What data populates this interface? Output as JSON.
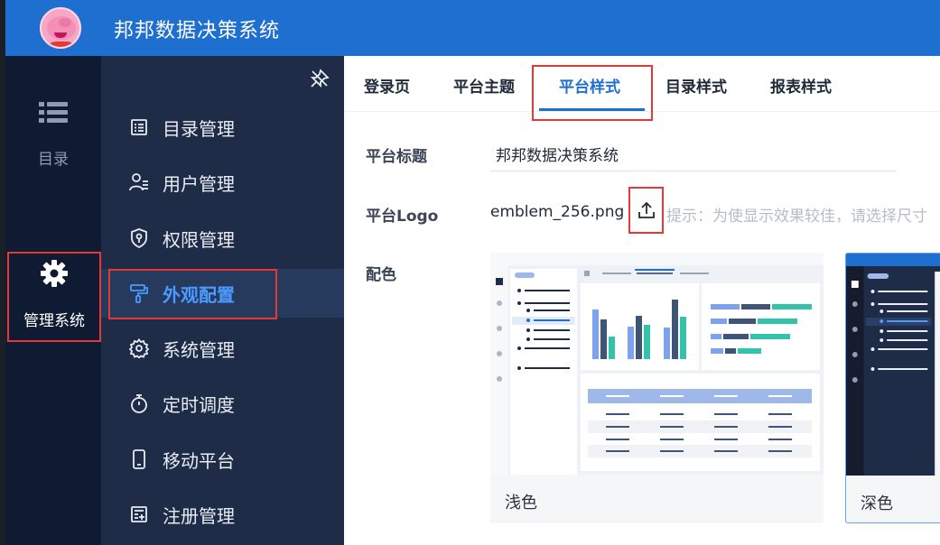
{
  "header": {
    "app_title": "邦邦数据决策系统"
  },
  "rail": {
    "items": [
      {
        "name": "list-icon",
        "label": "目录"
      },
      {
        "name": "gear-icon",
        "label": "管理系统"
      }
    ]
  },
  "menu": {
    "items": [
      {
        "label": "目录管理",
        "icon": "catalog-icon"
      },
      {
        "label": "用户管理",
        "icon": "user-icon"
      },
      {
        "label": "权限管理",
        "icon": "shield-icon"
      },
      {
        "label": "外观配置",
        "icon": "paint-roller-icon",
        "active": true
      },
      {
        "label": "系统管理",
        "icon": "gear-icon"
      },
      {
        "label": "定时调度",
        "icon": "stopwatch-icon"
      },
      {
        "label": "移动平台",
        "icon": "mobile-icon"
      },
      {
        "label": "注册管理",
        "icon": "register-icon"
      }
    ]
  },
  "tabs": [
    {
      "label": "登录页"
    },
    {
      "label": "平台主题"
    },
    {
      "label": "平台样式",
      "active": true
    },
    {
      "label": "目录样式"
    },
    {
      "label": "报表样式"
    }
  ],
  "form": {
    "title_label": "平台标题",
    "title_value": "邦邦数据决策系统",
    "logo_label": "平台Logo",
    "logo_file": "emblem_256.png",
    "logo_hint": "提示：为使显示效果较佳，请选择尺寸",
    "color_label": "配色",
    "themes": [
      {
        "label": "浅色"
      },
      {
        "label": "深色",
        "selected": true
      }
    ]
  },
  "colors": {
    "header": "#1e6fcf",
    "rail": "#0f1b33",
    "menu": "#1f2c47",
    "active_text": "#4b9bff",
    "highlight_border": "#e53935"
  }
}
